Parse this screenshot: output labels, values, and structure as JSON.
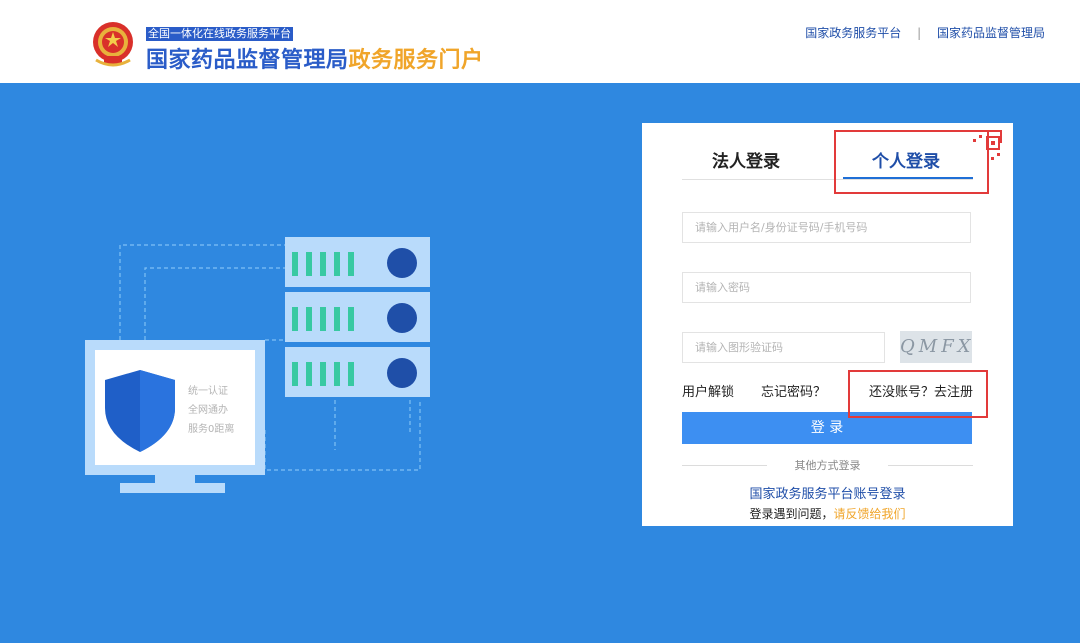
{
  "header": {
    "tagline": "全国一体化在线政务服务平台",
    "title_main": "国家药品监督管理局",
    "title_accent": "政务服务门户",
    "links": [
      "国家政务服务平台",
      "国家药品监督管理局"
    ],
    "separator": "|"
  },
  "illustration": {
    "monitor_lines": [
      "统一认证",
      "全网通办",
      "服务0距离"
    ]
  },
  "login": {
    "tabs": [
      "法人登录",
      "个人登录"
    ],
    "active_tab": "个人登录",
    "username_placeholder": "请输入用户名/身份证号码/手机号码",
    "password_placeholder": "请输入密码",
    "captcha_placeholder": "请输入图形验证码",
    "captcha_text": "QMFX",
    "links": {
      "unlock": "用户解锁",
      "forgot": "忘记密码？",
      "no_account": "还没账号？",
      "register": "去注册"
    },
    "login_button": "登 录",
    "other_methods": "其他方式登录",
    "gov_platform_login": "国家政务服务平台账号登录",
    "feedback_prefix": "登录遇到问题，",
    "feedback_link": "请反馈给我们"
  },
  "colors": {
    "background": "#2f88e0",
    "brand_blue": "#2a5cc8",
    "accent_orange": "#f0a52a",
    "button_blue": "#3d8ff2",
    "highlight_red": "#e23a3a"
  }
}
